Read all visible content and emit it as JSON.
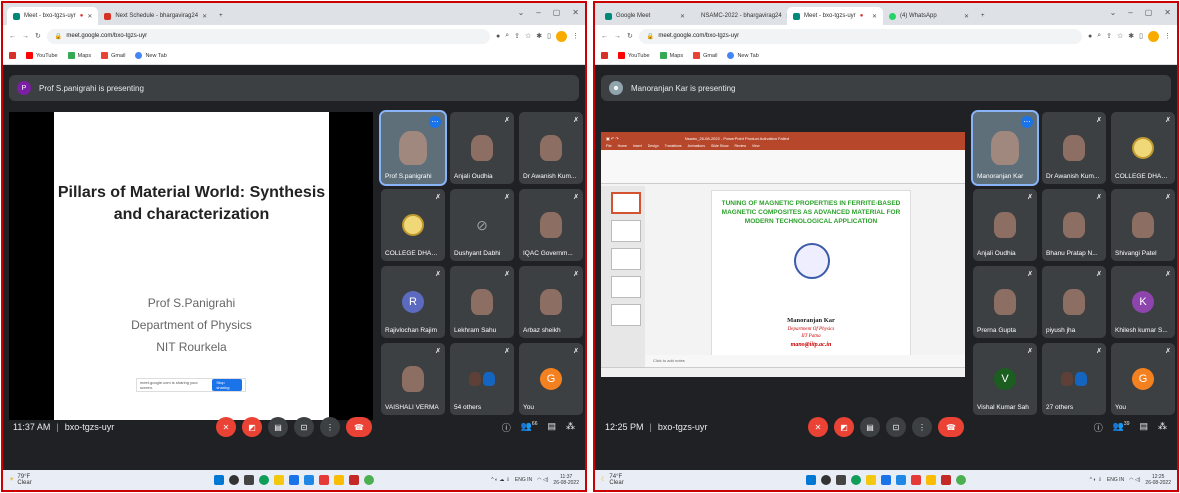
{
  "left": {
    "tabs": [
      {
        "label": "Meet - bxo-tgzs-uyr",
        "active": true
      },
      {
        "label": "Next Schedule - bhargavirag24",
        "active": false
      }
    ],
    "url": "meet.google.com/bxo-tgzs-uyr",
    "bookmarks": [
      "YouTube",
      "Maps",
      "Gmail",
      "New Tab"
    ],
    "presenter_banner": "Prof S.panigrahi is presenting",
    "presenter_initial": "P",
    "slide": {
      "title_line1": "Pillars of Material World: Synthesis",
      "title_line2": "and characterization",
      "line1": "Prof S.Panigrahi",
      "line2": "Department of Physics",
      "line3": "NIT Rourkela",
      "share_text": "meet.google.com is sharing your screen.",
      "share_button": "Stop sharing"
    },
    "participants": [
      {
        "name": "Prof S.panigrahi",
        "kind": "video"
      },
      {
        "name": "Anjali Oudhia",
        "kind": "photo"
      },
      {
        "name": "Dr Awanish Kum...",
        "kind": "photo"
      },
      {
        "name": "COLLEGE DHAR...",
        "kind": "logo"
      },
      {
        "name": "Dushyant Dabhi",
        "kind": "off"
      },
      {
        "name": "IQAC Governm...",
        "kind": "photo"
      },
      {
        "name": "Rajivlochan Rajim",
        "kind": "avatar",
        "initial": "R",
        "color": "#5c6bc0"
      },
      {
        "name": "Lekhram Sahu",
        "kind": "photo"
      },
      {
        "name": "Arbaz sheikh",
        "kind": "photo"
      },
      {
        "name": "VAISHALI VERMA",
        "kind": "photo"
      },
      {
        "name": "54 others",
        "kind": "group"
      },
      {
        "name": "You",
        "kind": "avatar",
        "initial": "G",
        "color": "#f4811f"
      }
    ],
    "time": "11:37 AM",
    "meeting_code": "bxo-tgzs-uyr",
    "participant_count": "66",
    "weather_temp": "79°F",
    "weather_desc": "Clear",
    "clock_time": "11:37",
    "clock_date": "26-08-2022",
    "lang": "ENG IN"
  },
  "right": {
    "tabs": [
      {
        "label": "Google Meet",
        "active": false
      },
      {
        "label": "NSAMC-2022 - bhargavirag24",
        "active": false
      },
      {
        "label": "Meet - bxo-tgzs-uyr",
        "active": true
      },
      {
        "label": "(4) WhatsApp",
        "active": false
      }
    ],
    "url": "meet.google.com/bxo-tgzs-uyr",
    "bookmarks": [
      "YouTube",
      "Maps",
      "Gmail",
      "New Tab"
    ],
    "presenter_banner": "Manoranjan Kar is presenting",
    "ppt": {
      "window_title": "Nsamc_26-08-2022 - PowerPoint Product Activation Failed",
      "menu": [
        "File",
        "Home",
        "Insert",
        "Design",
        "Transitions",
        "Animations",
        "Slide Show",
        "Review",
        "View"
      ],
      "title": "TUNING OF MAGNETIC PROPERTIES IN FERRITE-BASED MAGNETIC COMPOSITES AS ADVANCED MATERIAL FOR MODERN TECHNOLOGICAL APPLICATION",
      "name": "Manoranjan Kar",
      "dept": "Department Of Physics",
      "inst": "IIT Patna",
      "email": "mano@iitp.ac.in",
      "notes": "Click to add notes"
    },
    "participants": [
      {
        "name": "Manoranjan Kar",
        "kind": "video"
      },
      {
        "name": "Dr Awanish Kum...",
        "kind": "photo"
      },
      {
        "name": "COLLEGE DHAR...",
        "kind": "logo"
      },
      {
        "name": "Anjali Oudhia",
        "kind": "photo"
      },
      {
        "name": "Bhanu Pratap N...",
        "kind": "photo"
      },
      {
        "name": "Shivangi Patel",
        "kind": "photo"
      },
      {
        "name": "Prerna Gupta",
        "kind": "photo"
      },
      {
        "name": "piyush jha",
        "kind": "photo"
      },
      {
        "name": "Khilesh kumar S...",
        "kind": "avatar",
        "initial": "K",
        "color": "#8e44ad"
      },
      {
        "name": "Vishal Kumar Sah",
        "kind": "avatar",
        "initial": "V",
        "color": "#1b5e20"
      },
      {
        "name": "27 others",
        "kind": "group"
      },
      {
        "name": "You",
        "kind": "avatar",
        "initial": "G",
        "color": "#f4811f"
      }
    ],
    "time": "12:25 PM",
    "meeting_code": "bxo-tgzs-uyr",
    "participant_count": "39",
    "weather_temp": "74°F",
    "weather_desc": "Clear",
    "clock_time": "12:25",
    "clock_date": "26-08-2022",
    "lang": "ENG IN"
  }
}
